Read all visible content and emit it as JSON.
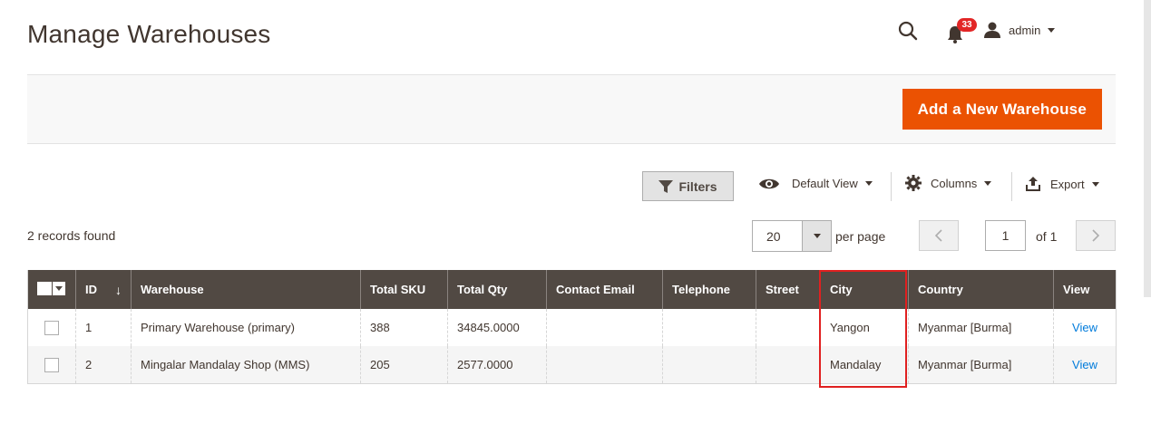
{
  "page": {
    "title": "Manage Warehouses"
  },
  "header": {
    "notification_count": "33",
    "user_name": "admin"
  },
  "actions": {
    "add_button": "Add a New Warehouse"
  },
  "toolbar": {
    "filters": "Filters",
    "view": "Default View",
    "columns": "Columns",
    "export": "Export"
  },
  "pager": {
    "records_found": "2 records found",
    "per_page_value": "20",
    "per_page_label": "per page",
    "current_page": "1",
    "of_pages": "of 1"
  },
  "grid": {
    "columns": [
      "ID",
      "Warehouse",
      "Total SKU",
      "Total Qty",
      "Contact Email",
      "Telephone",
      "Street",
      "City",
      "Country",
      "View"
    ],
    "rows": [
      {
        "id": "1",
        "warehouse": "Primary Warehouse (primary)",
        "total_sku": "388",
        "total_qty": "34845.0000",
        "email": "",
        "telephone": "",
        "street": "",
        "city": "Yangon",
        "country": "Myanmar [Burma]",
        "view": "View"
      },
      {
        "id": "2",
        "warehouse": "Mingalar Mandalay Shop (MMS)",
        "total_sku": "205",
        "total_qty": "2577.0000",
        "email": "",
        "telephone": "",
        "street": "",
        "city": "Mandalay",
        "country": "Myanmar [Burma]",
        "view": "View"
      }
    ]
  },
  "colors": {
    "accent": "#eb5202",
    "header_bg": "#514943",
    "link": "#007bdb",
    "badge": "#e22626",
    "highlight": "#e02020"
  },
  "sort_indicator": "↓"
}
